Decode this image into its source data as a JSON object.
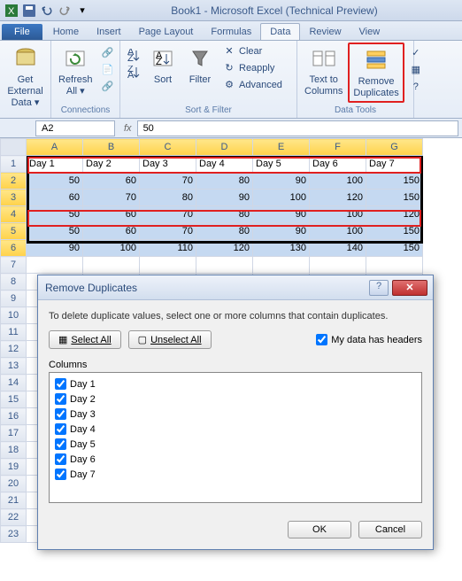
{
  "title": "Book1 - Microsoft Excel (Technical Preview)",
  "tabs": {
    "file": "File",
    "items": [
      "Home",
      "Insert",
      "Page Layout",
      "Formulas",
      "Data",
      "Review",
      "View"
    ],
    "active": 4
  },
  "ribbon": {
    "get_external": "Get External\nData ▾",
    "refresh": "Refresh\nAll ▾",
    "connections_label": "Connections",
    "sort_az": "A↓Z",
    "sort_za": "Z↓A",
    "sort": "Sort",
    "filter": "Filter",
    "clear": "Clear",
    "reapply": "Reapply",
    "advanced": "Advanced",
    "sortfilter_label": "Sort & Filter",
    "text_to_cols": "Text to\nColumns",
    "remove_dup": "Remove\nDuplicates",
    "datatools_label": "Data Tools"
  },
  "namebox": "A2",
  "formula": "50",
  "columns": [
    "A",
    "B",
    "C",
    "D",
    "E",
    "F",
    "G"
  ],
  "headers": [
    "Day 1",
    "Day 2",
    "Day 3",
    "Day 4",
    "Day 5",
    "Day 6",
    "Day 7"
  ],
  "rows": [
    [
      50,
      60,
      70,
      80,
      90,
      100,
      150
    ],
    [
      60,
      70,
      80,
      90,
      100,
      120,
      150
    ],
    [
      50,
      60,
      70,
      80,
      90,
      100,
      120
    ],
    [
      50,
      60,
      70,
      80,
      90,
      100,
      150
    ],
    [
      90,
      100,
      110,
      120,
      130,
      140,
      150
    ]
  ],
  "rownums": [
    1,
    2,
    3,
    4,
    5,
    6,
    7,
    8,
    9,
    10,
    11,
    12,
    13,
    14,
    15,
    16,
    17,
    18,
    19,
    20,
    21,
    22,
    23
  ],
  "dialog": {
    "title": "Remove Duplicates",
    "desc": "To delete duplicate values, select one or more columns that contain duplicates.",
    "select_all": "Select All",
    "unselect_all": "Unselect All",
    "headers_check": "My data has headers",
    "columns_label": "Columns",
    "items": [
      "Day 1",
      "Day 2",
      "Day 3",
      "Day 4",
      "Day 5",
      "Day 6",
      "Day 7"
    ],
    "ok": "OK",
    "cancel": "Cancel"
  }
}
